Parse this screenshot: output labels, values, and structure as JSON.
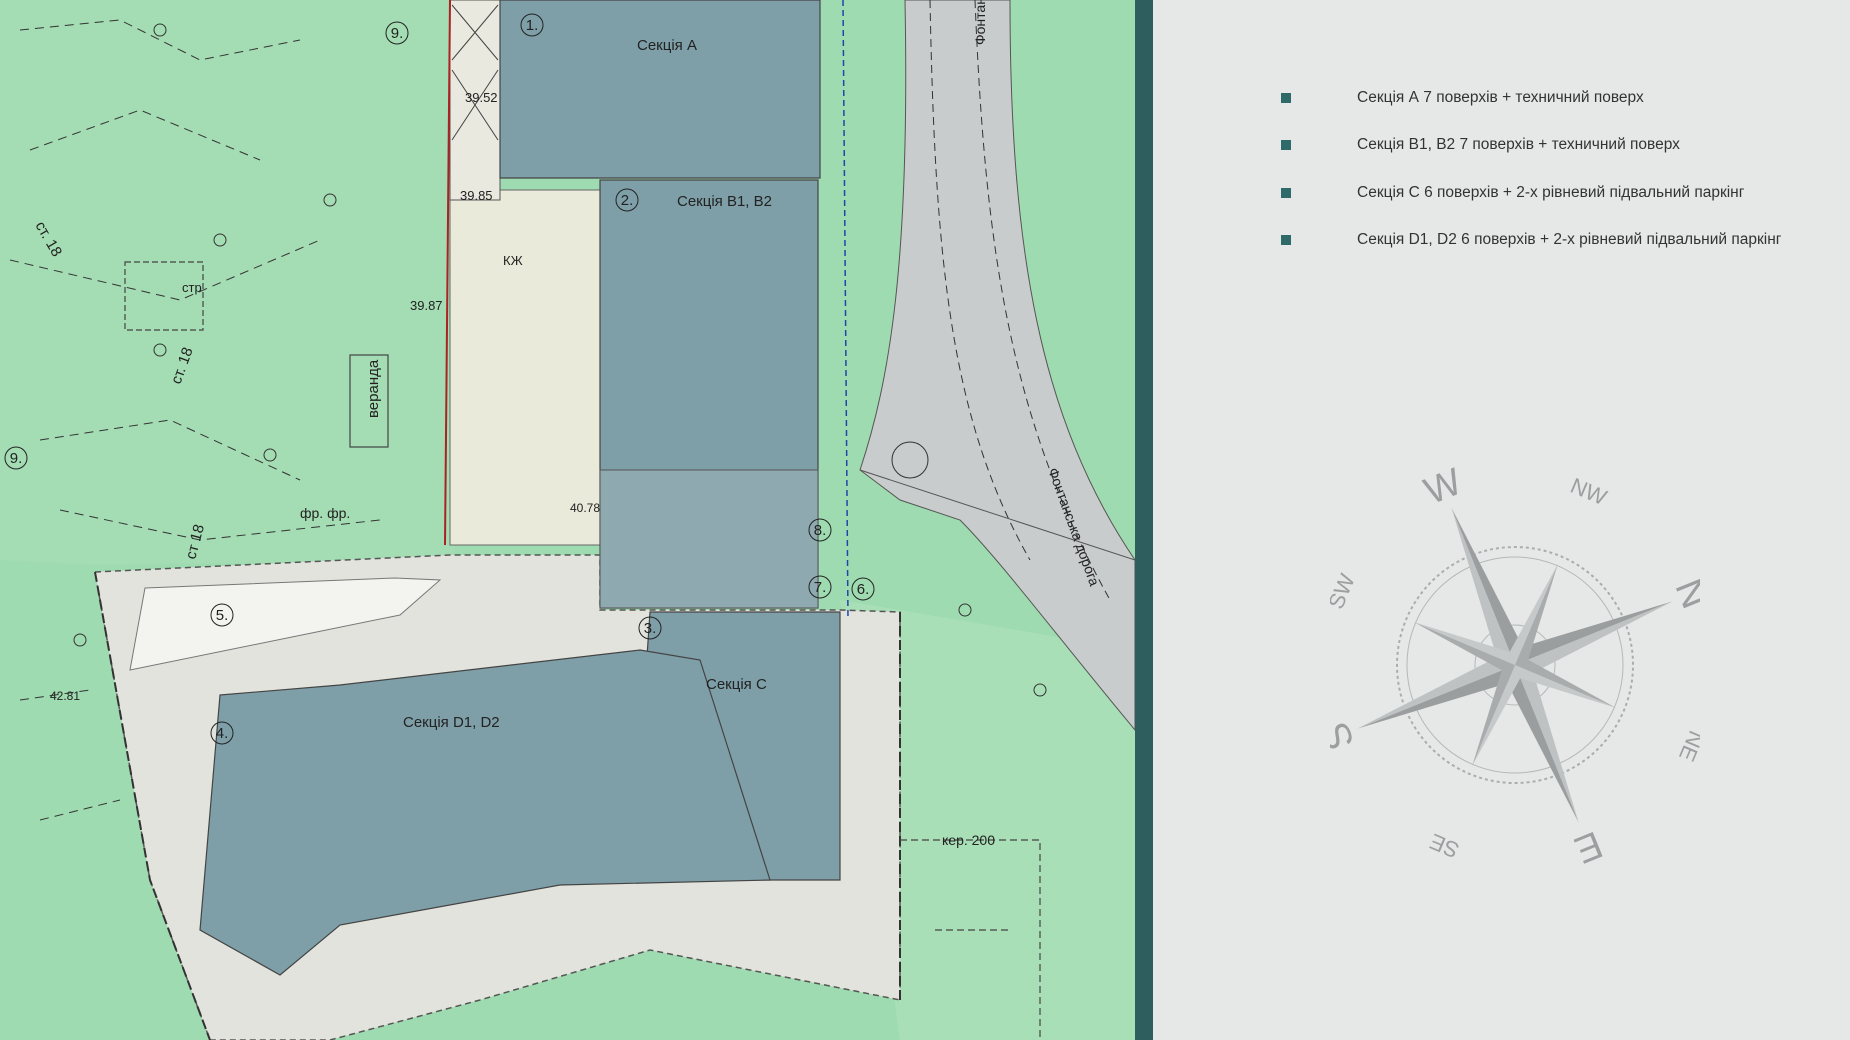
{
  "map": {
    "sections": {
      "a": "Секція А",
      "b": "Секція В1, В2",
      "c": "Секція С",
      "d": "Секція D1, D2"
    },
    "numbers": {
      "n1": "1.",
      "n2": "2.",
      "n3": "3.",
      "n4": "4.",
      "n5": "5.",
      "n6": "6.",
      "n7": "7.",
      "n8": "8.",
      "n9a": "9.",
      "n9b": "9."
    },
    "street_top": "Фонтанськ",
    "street_bottom": "Фонтанська дорога",
    "labels": {
      "veranda": "веранда",
      "st18a": "ст. 18",
      "st18b": "ст. 18",
      "st18c": "ст 18",
      "str": "стр",
      "kzh": "КЖ",
      "ker": "кер. 200",
      "fr": "фр. фр.",
      "h1": "39.52",
      "h2": "39.85",
      "h3": "39.87",
      "h4": "40.78",
      "h5": "42.81"
    }
  },
  "legend": [
    {
      "label": "Секція А 7 поверхів + техничний поверх"
    },
    {
      "label": "Секція В1, В2 7 поверхів + техничний поверх"
    },
    {
      "label": "Секція С 6 поверхів + 2-х рівневий підвальний паркінг"
    },
    {
      "label": "Секція D1, D2 6 поверхів + 2-х рівневий підвальний паркінг"
    }
  ],
  "compass": {
    "N": "N",
    "S": "S",
    "W": "W",
    "E": "E",
    "NW": "NW",
    "NE": "NE",
    "SW": "SW",
    "SE": "SE"
  },
  "colors": {
    "green": "#9fdbb0",
    "building": "#7e9fa8",
    "road": "#c9cccc",
    "paving": "#e3e3dd",
    "accent": "#2f5e5e"
  }
}
